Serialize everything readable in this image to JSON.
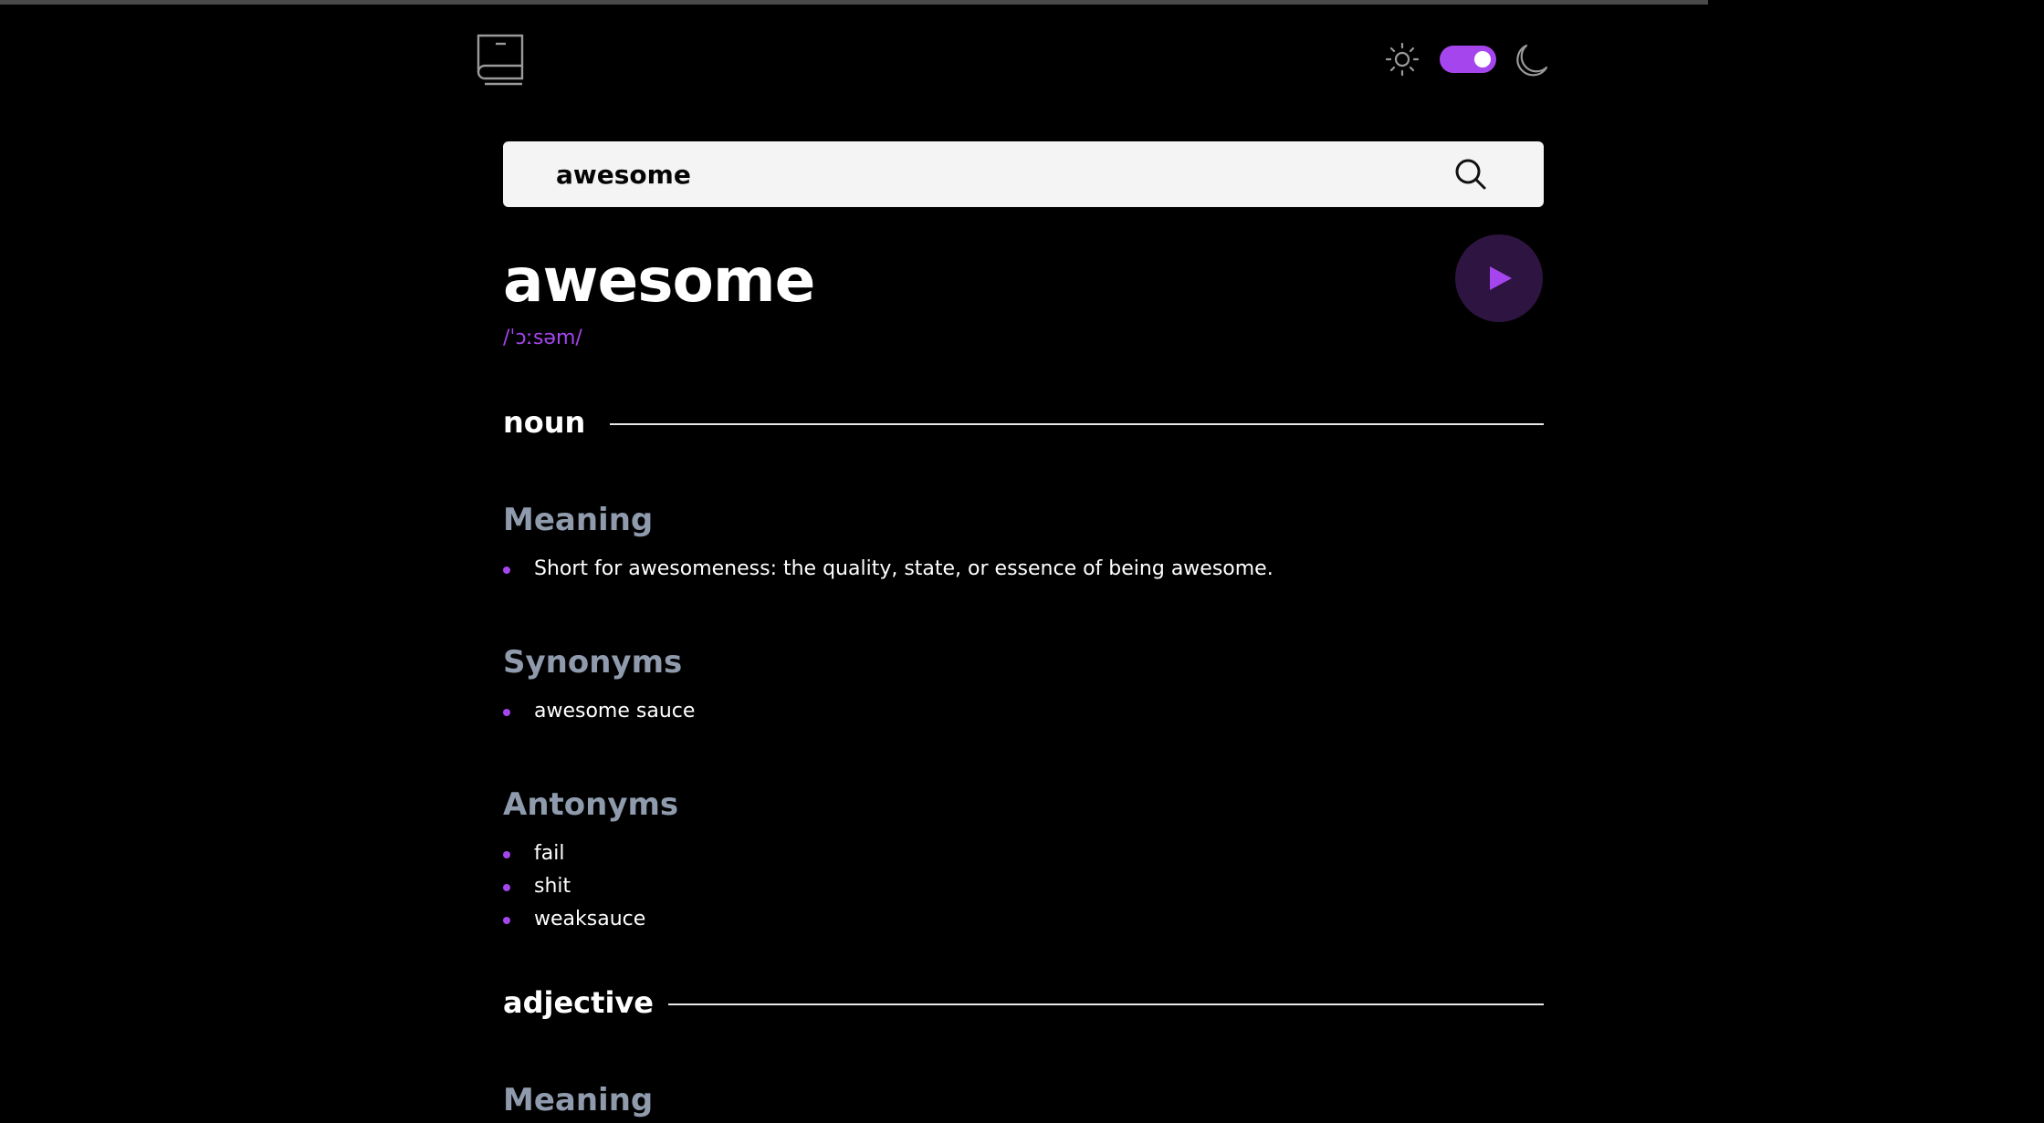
{
  "search": {
    "value": "awesome"
  },
  "entry": {
    "word": "awesome",
    "phonetic": "/ˈɔːsəm/"
  },
  "noun": {
    "label": "noun",
    "meaning_title": "Meaning",
    "meanings": [
      "Short for awesomeness: the quality, state, or essence of being awesome."
    ],
    "synonyms_title": "Synonyms",
    "synonyms": [
      "awesome sauce"
    ],
    "antonyms_title": "Antonyms",
    "antonyms": [
      "fail",
      "shit",
      "weaksauce"
    ]
  },
  "adjective": {
    "label": "adjective",
    "meaning_title": "Meaning"
  },
  "theme": {
    "dark_mode": true
  },
  "colors": {
    "accent": "#a445ed",
    "background": "#000000",
    "muted_heading": "#8f9bad",
    "search_bg": "#f4f4f4"
  },
  "icons": [
    "book-logo-icon",
    "sun-icon",
    "moon-icon",
    "search-icon",
    "play-icon"
  ]
}
